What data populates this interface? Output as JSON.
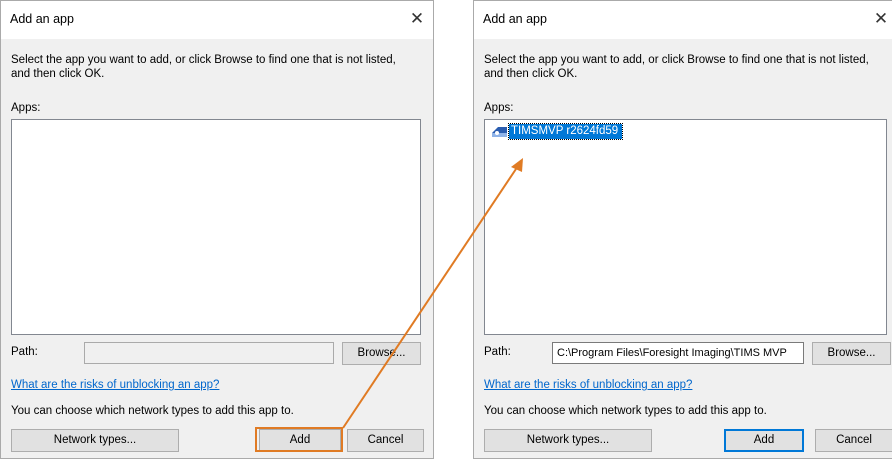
{
  "left_dialog": {
    "title": "Add an app",
    "description": "Select the app you want to add, or click Browse to find one that is not listed, and then click OK.",
    "apps_label": "Apps:",
    "path_label": "Path:",
    "path_value": "",
    "browse_label": "Browse...",
    "risk_link": "What are the risks of unblocking an app?",
    "network_text": "You can choose which network types to add this app to.",
    "network_button": "Network types...",
    "add_button": "Add",
    "cancel_button": "Cancel"
  },
  "right_dialog": {
    "title": "Add an app",
    "description": "Select the app you want to add, or click Browse to find one that is not listed, and then click OK.",
    "apps_label": "Apps:",
    "app_item": "TIMSMVP r2624fd59",
    "path_label": "Path:",
    "path_value": "C:\\Program Files\\Foresight Imaging\\TIMS MVP",
    "browse_label": "Browse...",
    "risk_link": "What are the risks of unblocking an app?",
    "network_text": "You can choose which network types to add this app to.",
    "network_button": "Network types...",
    "add_button": "Add",
    "cancel_button": "Cancel"
  },
  "icons": {
    "close": "close-icon",
    "app": "app-icon"
  },
  "colors": {
    "highlight": "#e07b24",
    "selection": "#0078d7",
    "link": "#0066cc"
  }
}
